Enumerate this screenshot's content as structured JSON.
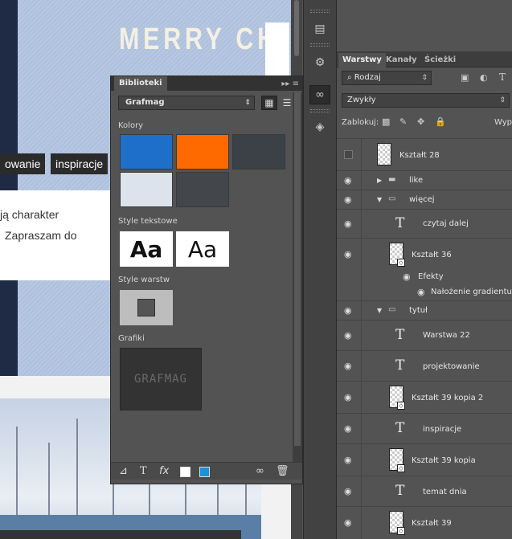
{
  "canvas": {
    "hero_text": "MERRY CH",
    "tags": [
      "owanie",
      "inspiracje"
    ],
    "lines": [
      "ją charakter",
      "Zapraszam do"
    ]
  },
  "libraries": {
    "tab_label": "Biblioteki",
    "library_name": "Grafmag",
    "sections": {
      "colors": "Kolory",
      "text_styles": "Style tekstowe",
      "layer_styles": "Style warstw",
      "graphics": "Grafiki"
    },
    "swatches": [
      "#1e6fc9",
      "#ff6a00",
      "#3c4047",
      "#dde3ec",
      "#43464b"
    ],
    "text_style_samples": [
      "Aa",
      "Aa"
    ],
    "graphic_label": "GRAFMAG",
    "footer_color_fill": "#ffffff",
    "footer_color_stroke": "#1e90d6"
  },
  "layers": {
    "tabs": [
      "Warstwy",
      "Kanały",
      "Ścieżki"
    ],
    "filter_type": "Rodzaj",
    "blend_mode": "Zwykły",
    "lock_label": "Zablokuj:",
    "fill_label": "Wype",
    "items": [
      {
        "name": "Kształt 28",
        "kind": "shape",
        "visible": false
      },
      {
        "name": "like",
        "kind": "folder",
        "visible": true,
        "expanded": false
      },
      {
        "name": "więcej",
        "kind": "folder",
        "visible": true,
        "expanded": true
      },
      {
        "name": "czytaj dalej",
        "kind": "text",
        "visible": true
      },
      {
        "name": "Kształt 36",
        "kind": "shape",
        "visible": true
      },
      {
        "name": "Efekty",
        "kind": "effect",
        "visible": true
      },
      {
        "name": "Nałożenie gradientu",
        "kind": "effect",
        "visible": true
      },
      {
        "name": "tytuł",
        "kind": "folder",
        "visible": true,
        "expanded": true
      },
      {
        "name": "Warstwa 22",
        "kind": "text",
        "visible": true
      },
      {
        "name": "projektowanie",
        "kind": "text",
        "visible": true
      },
      {
        "name": "Kształt 39 kopia 2",
        "kind": "shape",
        "visible": true
      },
      {
        "name": "inspiracje",
        "kind": "text",
        "visible": true
      },
      {
        "name": "Kształt 39 kopia",
        "kind": "shape",
        "visible": true
      },
      {
        "name": "temat dnia",
        "kind": "text",
        "visible": true
      },
      {
        "name": "Kształt 39",
        "kind": "shape",
        "visible": true
      }
    ]
  }
}
